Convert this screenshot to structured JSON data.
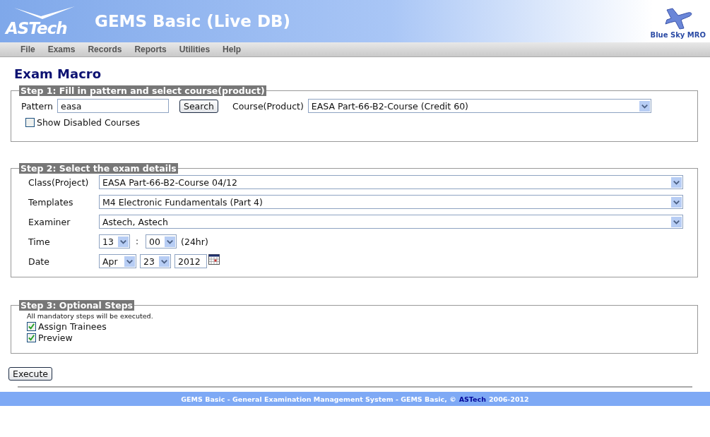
{
  "header": {
    "logo": "ASTech",
    "app_title": "GEMS Basic (Live DB)",
    "brand": "Blue Sky MRO"
  },
  "menu": [
    "File",
    "Exams",
    "Records",
    "Reports",
    "Utilities",
    "Help"
  ],
  "page_title": "Exam Macro",
  "step1": {
    "legend": "Step 1: Fill in pattern and select course(product)",
    "pattern": {
      "label": "Pattern",
      "value": "easa"
    },
    "search_button": "Search",
    "course": {
      "label": "Course(Product)",
      "value": "EASA Part-66-B2-Course (Credit 60)"
    },
    "show_disabled": {
      "label": "Show Disabled Courses",
      "checked": false
    }
  },
  "step2": {
    "legend": "Step 2: Select the exam details",
    "selects": [
      {
        "label": "Class(Project)",
        "value": "EASA Part-66-B2-Course 04/12"
      },
      {
        "label": "Templates",
        "value": "M4 Electronic Fundamentals (Part 4)"
      },
      {
        "label": "Examiner",
        "value": "Astech, Astech"
      }
    ],
    "time": {
      "label": "Time",
      "hour": "13",
      "separator": ":",
      "minute": "00",
      "note": "(24hr)"
    },
    "date": {
      "label": "Date",
      "month": "Apr",
      "day": "23",
      "year": "2012"
    }
  },
  "step3": {
    "legend": "Step 3: Optional Steps",
    "note": "All mandatory steps will be executed.",
    "options": [
      {
        "label": "Assign Trainees",
        "checked": true
      },
      {
        "label": "Preview",
        "checked": true
      }
    ]
  },
  "execute_button": "Execute",
  "footer": {
    "prefix": "GEMS Basic - General Examination Management System - GEMS Basic, ©",
    "link": "ASTech",
    "suffix": "2006-2012"
  }
}
